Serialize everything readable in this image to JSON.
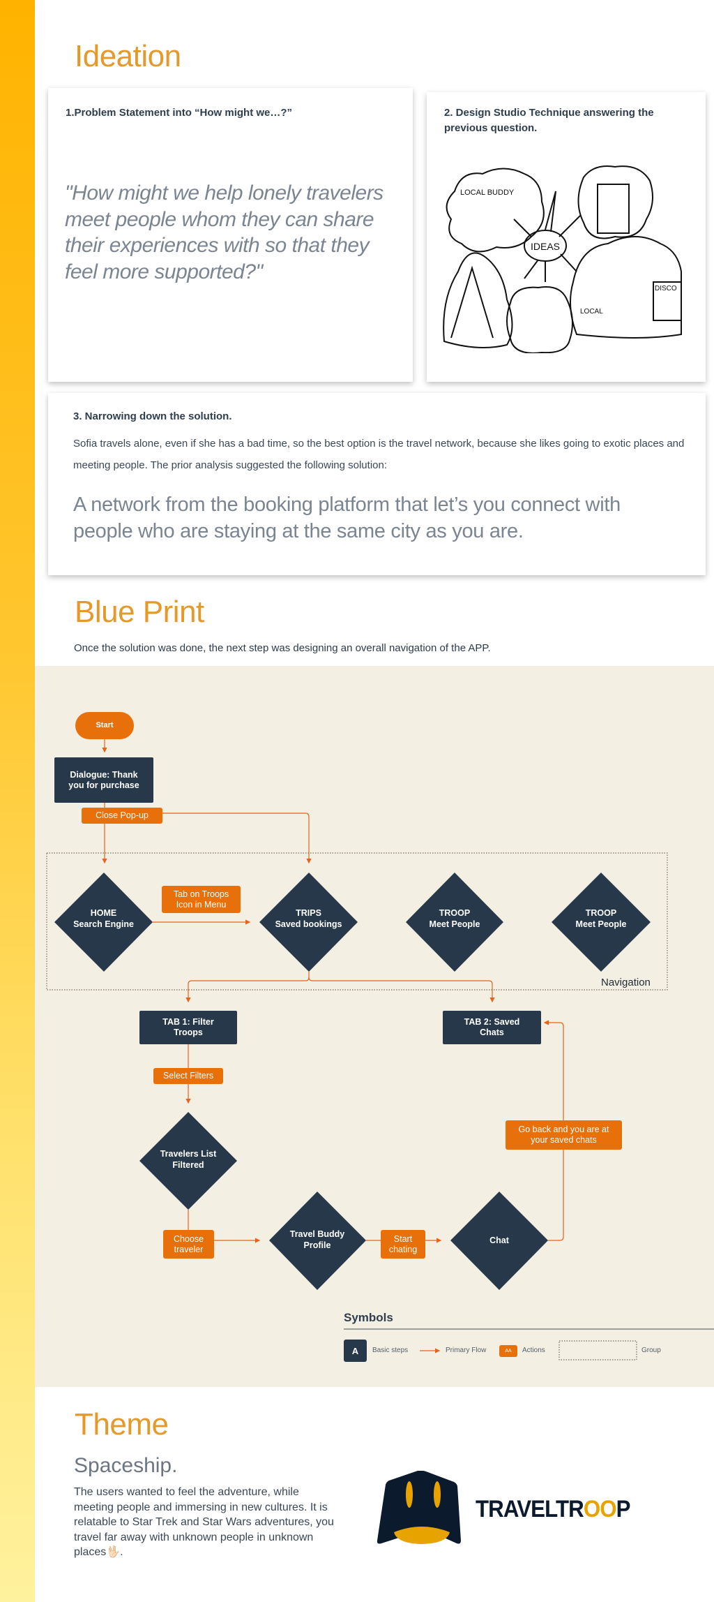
{
  "ideation": {
    "title": "Ideation",
    "card1": {
      "heading": "1.Problem Statement into “How might we…?”",
      "quote": "\"How might we help lonely travelers meet people whom they can share their experiences with so that they feel more supported?\""
    },
    "card2": {
      "heading": "2. Design Studio Technique answering the previous question.",
      "sketch_labels": {
        "center": "IDEAS",
        "buddy": "LOCAL BUDDY",
        "disco": "DISCO",
        "local": "LOCAL"
      }
    },
    "card3": {
      "heading": "3. Narrowing down the solution.",
      "paragraph": "Sofia travels alone, even if she has a bad time, so the best option is the travel network, because she likes going to exotic places and meeting people. The prior analysis suggested the following solution:",
      "solution": "A network from the booking platform that let’s you  connect with people who are staying at the same city as you are."
    }
  },
  "blueprint": {
    "title": "Blue Print",
    "subtitle": "Once the solution was done, the next step was designing an overall navigation of the APP.",
    "nodes": {
      "start": "Start",
      "dialogue": "Dialogue: Thank you for purchase",
      "close_popup": "Close Pop-up",
      "home": [
        "HOME",
        "Search Engine"
      ],
      "tab_troops": "Tab on Troops Icon in Menu",
      "trips": [
        "TRIPS",
        "Saved bookings"
      ],
      "troop1": [
        "TROOP",
        "Meet People"
      ],
      "troop2": [
        "TROOP",
        "Meet People"
      ],
      "navigation": "Navigation",
      "tab1": "TAB 1: Filter Troops",
      "tab2": "TAB 2: Saved Chats",
      "select_filters": "Select Filters",
      "travelers_list": "Travelers List Filtered",
      "choose_traveler": "Choose traveler",
      "buddy_profile": "Travel Buddy Profile",
      "start_chatting": "Start chating",
      "chat": "Chat",
      "go_back": "Go back and you are at your saved chats"
    },
    "symbols": {
      "title": "Symbols",
      "basic_glyph": "A",
      "basic": "Basic steps",
      "primary": "Primary Flow",
      "actions_glyph": "AA",
      "actions": "Actions",
      "group": "Group"
    },
    "colors": {
      "node": "#263849",
      "action": "#e8700a",
      "flow": "#e8621a",
      "background": "#f3efe3"
    }
  },
  "theme": {
    "title": "Theme",
    "subtitle": "Spaceship.",
    "paragraph": "The users wanted to feel the adventure, while meeting people and immersing in new cultures. It is relatable to Star Trek and Star Wars adventures, you travel far away with unknown people in unknown places🖖🏻.",
    "logo": {
      "part1": "TRAVELTR",
      "part2": "OO",
      "part3": "P"
    }
  },
  "colors": {
    "accent": "#e39a2b",
    "text": "#2d3b4b"
  }
}
